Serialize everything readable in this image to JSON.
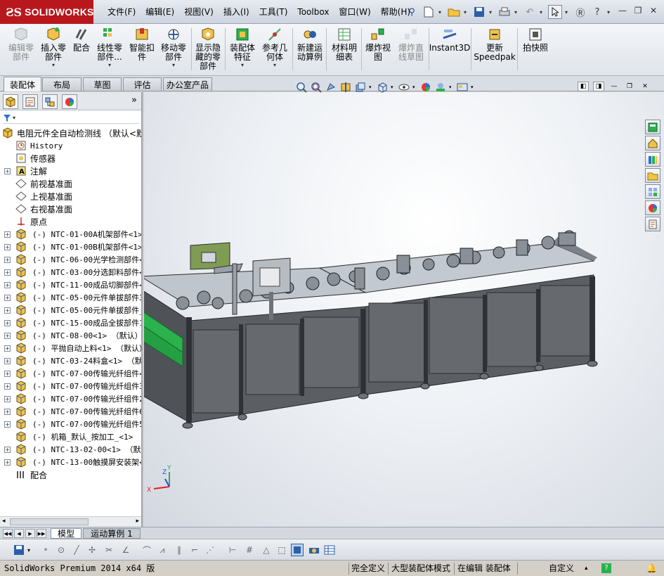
{
  "app": {
    "brand": "SOLIDWORKS",
    "menu": [
      "文件(F)",
      "编辑(E)",
      "视图(V)",
      "插入(I)",
      "工具(T)",
      "Toolbox",
      "窗口(W)",
      "帮助(H)"
    ]
  },
  "command_manager": {
    "commands": [
      {
        "label": "编辑零\n部件",
        "icon": "edit-component-icon",
        "disabled": true
      },
      {
        "label": "插入零\n部件",
        "icon": "insert-components-icon",
        "disabled": false,
        "dropdown": true
      },
      {
        "label": "配合",
        "icon": "mate-icon",
        "disabled": false
      },
      {
        "label": "线性零\n部件...",
        "icon": "linear-pattern-icon",
        "disabled": false,
        "dropdown": true
      },
      {
        "label": "智能扣\n件",
        "icon": "smart-fasteners-icon",
        "disabled": false
      },
      {
        "label": "移动零\n部件",
        "icon": "move-component-icon",
        "disabled": false,
        "dropdown": true
      },
      {
        "label": "显示隐\n藏的零\n部件",
        "icon": "show-hidden-icon",
        "disabled": false
      },
      {
        "label": "装配体\n特征",
        "icon": "assembly-features-icon",
        "disabled": false,
        "dropdown": true
      },
      {
        "label": "参考几\n何体",
        "icon": "reference-geometry-icon",
        "disabled": false,
        "dropdown": true
      },
      {
        "label": "新建运\n动算例",
        "icon": "new-motion-study-icon",
        "disabled": false
      },
      {
        "label": "材料明\n细表",
        "icon": "bill-of-materials-icon",
        "disabled": false
      },
      {
        "label": "爆炸视\n图",
        "icon": "exploded-view-icon",
        "disabled": false
      },
      {
        "label": "爆炸直\n线草图",
        "icon": "explode-line-sketch-icon",
        "disabled": true
      },
      {
        "label": "Instant3D",
        "icon": "instant3d-icon",
        "disabled": false
      },
      {
        "label": "更新\nSpeedpak",
        "icon": "speedpak-icon",
        "disabled": false
      },
      {
        "label": "拍快照",
        "icon": "snapshot-icon",
        "disabled": false
      }
    ],
    "tabs": [
      "装配体",
      "布局",
      "草图",
      "评估",
      "办公室产品"
    ],
    "active_tab": "装配体"
  },
  "feature_tree": {
    "root": "电阻元件全自动检测线 （默认<默",
    "items": [
      {
        "text": "History",
        "icon": "history-icon",
        "expand": false,
        "mono": true
      },
      {
        "text": "传感器",
        "icon": "sensors-icon",
        "expand": false,
        "mono": false
      },
      {
        "text": "注解",
        "icon": "annotations-icon",
        "expand": true,
        "mono": false
      },
      {
        "text": "前视基准面",
        "icon": "plane-icon",
        "expand": false,
        "mono": false
      },
      {
        "text": "上视基准面",
        "icon": "plane-icon",
        "expand": false,
        "mono": false
      },
      {
        "text": "右视基准面",
        "icon": "plane-icon",
        "expand": false,
        "mono": false
      },
      {
        "text": "原点",
        "icon": "origin-icon",
        "expand": false,
        "mono": false
      },
      {
        "text": "(-) NTC-01-00A机架部件<1>",
        "icon": "subassembly-icon",
        "expand": true,
        "mono": true
      },
      {
        "text": "(-) NTC-01-00B机架部件<1>",
        "icon": "subassembly-icon",
        "expand": true,
        "mono": true
      },
      {
        "text": "(-) NTC-06-00光学检测部件<",
        "icon": "subassembly-icon",
        "expand": true,
        "mono": true
      },
      {
        "text": "(-) NTC-03-00分选卸料部件<",
        "icon": "subassembly-icon",
        "expand": true,
        "mono": true
      },
      {
        "text": "(-) NTC-11-00成品切脚部件<",
        "icon": "subassembly-icon",
        "expand": true,
        "mono": true
      },
      {
        "text": "(-) NTC-05-00元件单拔部件3",
        "icon": "subassembly-icon",
        "expand": true,
        "mono": true
      },
      {
        "text": "(-) NTC-05-00元件单拔部件_",
        "icon": "subassembly-icon",
        "expand": true,
        "mono": true
      },
      {
        "text": "(-) NTC-15-00成品全拔部件1",
        "icon": "subassembly-icon",
        "expand": true,
        "mono": true
      },
      {
        "text": "(-) NTC-08-00<1> （默认）",
        "icon": "subassembly-icon",
        "expand": true,
        "mono": true
      },
      {
        "text": "(-) 平抛自动上料<1> （默认）",
        "icon": "subassembly-icon",
        "expand": true,
        "mono": true
      },
      {
        "text": "(-) NTC-03-24料盒<1> （默认",
        "icon": "subassembly-icon",
        "expand": true,
        "mono": true
      },
      {
        "text": "(-) NTC-07-00传输光纤组件<",
        "icon": "subassembly-icon",
        "expand": true,
        "mono": true
      },
      {
        "text": "(-) NTC-07-00传输光纤组件3",
        "icon": "subassembly-icon",
        "expand": true,
        "mono": true
      },
      {
        "text": "(-) NTC-07-00传输光纤组件2",
        "icon": "subassembly-icon",
        "expand": true,
        "mono": true
      },
      {
        "text": "(-) NTC-07-00传输光纤组件6",
        "icon": "subassembly-icon",
        "expand": true,
        "mono": true
      },
      {
        "text": "(-) NTC-07-00传输光纤组件5",
        "icon": "subassembly-icon",
        "expand": true,
        "mono": true
      },
      {
        "text": "(-) 机箱_默认_按加工_<1> （",
        "icon": "subassembly-icon",
        "expand": false,
        "mono": true
      },
      {
        "text": "(-) NTC-13-02-00<1> （默认）",
        "icon": "subassembly-icon",
        "expand": true,
        "mono": true
      },
      {
        "text": "(-) NTC-13-00触摸屏安装架<",
        "icon": "subassembly-icon",
        "expand": true,
        "mono": true
      },
      {
        "text": "配合",
        "icon": "mates-folder-icon",
        "expand": false,
        "mono": false
      }
    ]
  },
  "triad": {
    "x": "X",
    "y": "Y",
    "z": "Z"
  },
  "model_tabs": [
    "模型",
    "运动算例 1"
  ],
  "status": {
    "product": "SolidWorks Premium 2014 x64 版",
    "units": "完全定义",
    "mode": "大型装配体模式",
    "editing": "在编辑 装配体",
    "custom": "自定义"
  },
  "colors": {
    "logo_red": "#b8181d",
    "cabinet": "#5b5e63",
    "frame": "#3a3d42",
    "accent_green": "#2bb24c"
  }
}
